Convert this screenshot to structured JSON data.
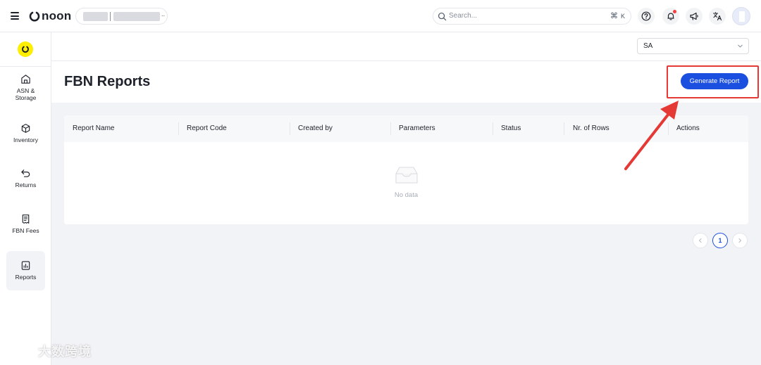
{
  "topbar": {
    "logo_text": "noon",
    "store_separator": "|",
    "store_overflow": "..",
    "search_placeholder": "Search...",
    "shortcut_symbol": "⌘",
    "shortcut_key": "K"
  },
  "sidebar": {
    "items": [
      {
        "label": "ASN & Storage",
        "icon": "warehouse-icon"
      },
      {
        "label": "Inventory",
        "icon": "box-icon"
      },
      {
        "label": "Returns",
        "icon": "return-arrow-icon"
      },
      {
        "label": "FBN Fees",
        "icon": "receipt-icon"
      },
      {
        "label": "Reports",
        "icon": "report-icon",
        "active": true
      }
    ]
  },
  "filters": {
    "country_value": "SA"
  },
  "page": {
    "title": "FBN Reports",
    "generate_button": "Generate Report"
  },
  "table": {
    "columns": [
      "Report Name",
      "Report Code",
      "Created by",
      "Parameters",
      "Status",
      "Nr. of Rows",
      "Actions"
    ],
    "rows": [],
    "empty_text": "No data"
  },
  "pagination": {
    "current_page": "1"
  },
  "watermark": "大数跨境",
  "colors": {
    "primary": "#1b4fe0",
    "brand_yellow": "#feee00",
    "annotation_red": "#e53935"
  }
}
